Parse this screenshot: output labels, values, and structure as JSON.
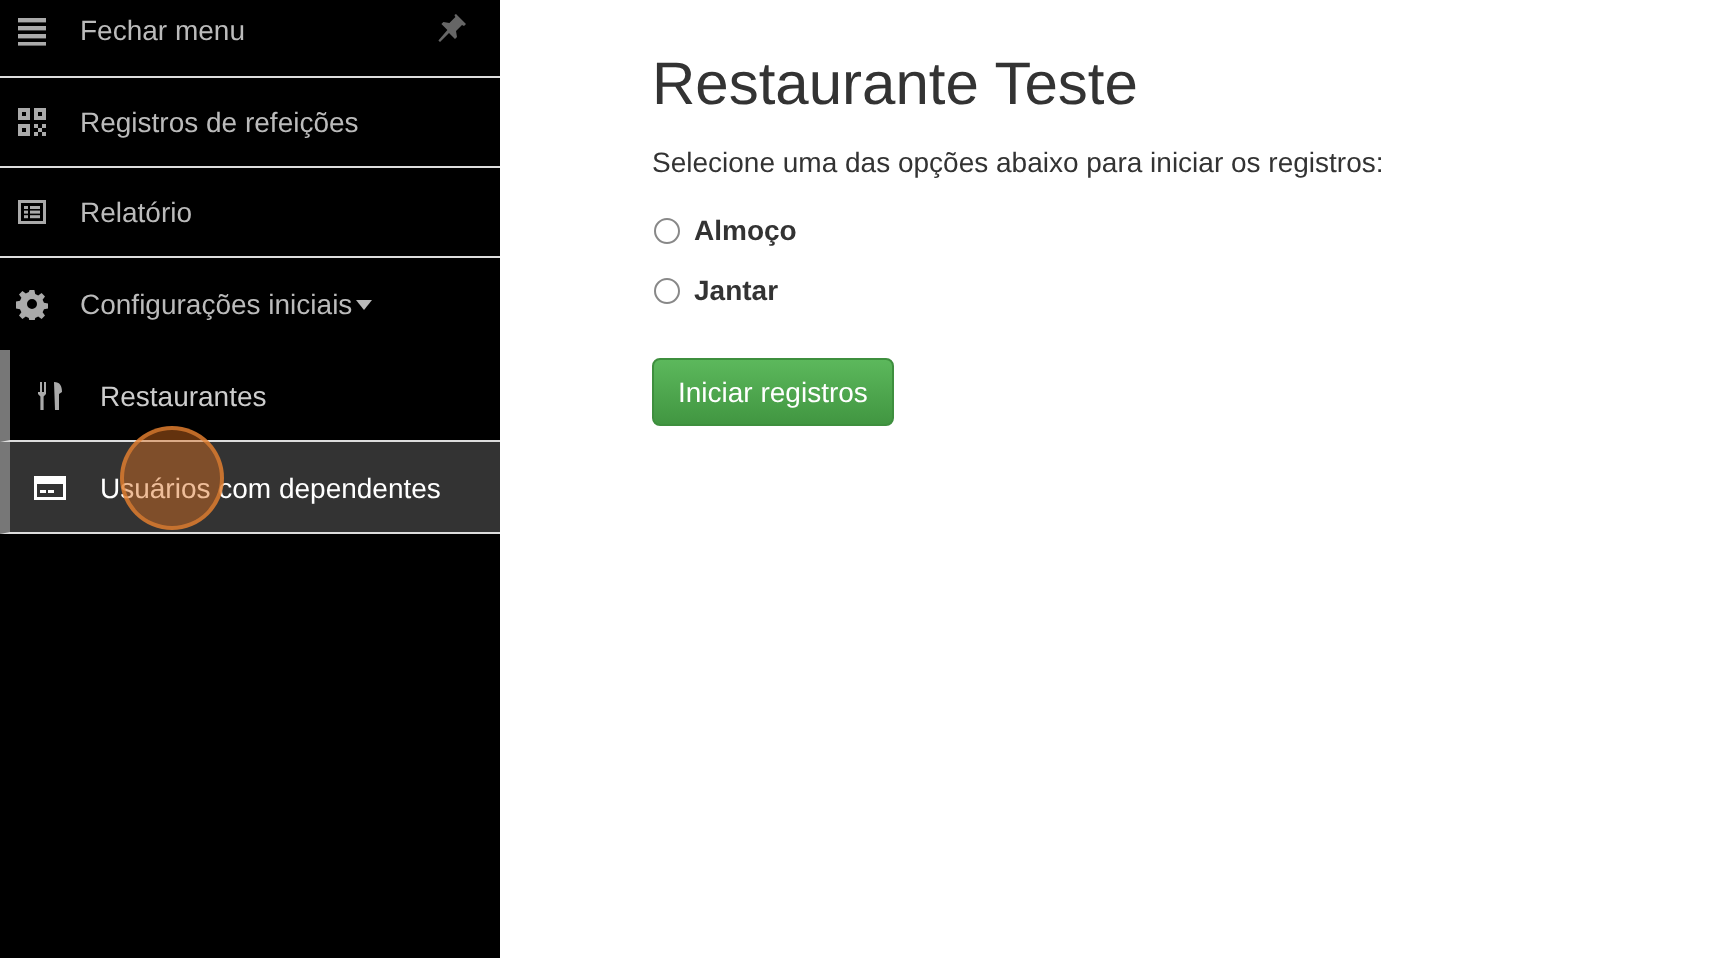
{
  "sidebar": {
    "items": [
      {
        "kind": "toggle",
        "label": "Fechar menu",
        "selected": false
      },
      {
        "kind": "link",
        "label": "Registros de refeições",
        "selected": false
      },
      {
        "kind": "link",
        "label": "Relatório",
        "selected": false
      },
      {
        "kind": "dropdown",
        "label": "Configurações iniciais",
        "expanded": true,
        "selected": false,
        "children": [
          {
            "kind": "sublink",
            "label": "Restaurantes",
            "selected": false
          },
          {
            "kind": "sublink",
            "label": "Usuários com dependentes",
            "selected": true
          }
        ]
      }
    ]
  },
  "main": {
    "title": "Restaurante Teste",
    "instruction": "Selecione uma das opções abaixo para iniciar os registros:",
    "options": [
      {
        "label": "Almoço",
        "selected": false
      },
      {
        "label": "Jantar",
        "selected": false
      }
    ],
    "button": "Iniciar registros"
  }
}
